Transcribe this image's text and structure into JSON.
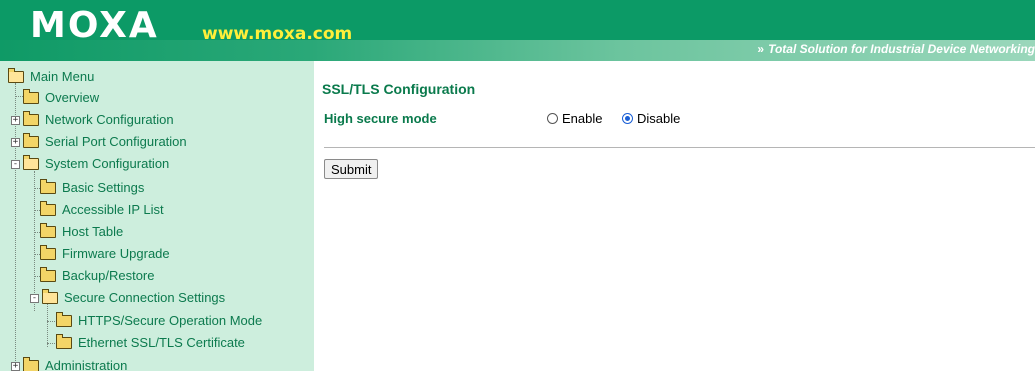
{
  "header": {
    "logo_text": "MOXA",
    "url_text": "www.moxa.com",
    "tagline_icon": "double-chevron-right-icon",
    "tagline": "Total Solution for Industrial Device Networking",
    "colors": {
      "bar": "#0c9a66",
      "url": "#ffef3a"
    }
  },
  "sidebar": {
    "root_label": "Main Menu",
    "items": [
      {
        "label": "Overview",
        "icon": "folder-icon"
      },
      {
        "label": "Network Configuration",
        "icon": "folder-icon",
        "expander": "+"
      },
      {
        "label": "Serial Port Configuration",
        "icon": "folder-icon",
        "expander": "+"
      },
      {
        "label": "System Configuration",
        "icon": "folder-open-icon",
        "expander": "-"
      },
      {
        "label": "Basic Settings",
        "icon": "folder-icon"
      },
      {
        "label": "Accessible IP List",
        "icon": "folder-icon"
      },
      {
        "label": "Host Table",
        "icon": "folder-icon"
      },
      {
        "label": "Firmware Upgrade",
        "icon": "folder-icon"
      },
      {
        "label": "Backup/Restore",
        "icon": "folder-icon"
      },
      {
        "label": "Secure Connection Settings",
        "icon": "folder-open-icon",
        "expander": "-"
      },
      {
        "label": "HTTPS/Secure Operation Mode",
        "icon": "folder-icon"
      },
      {
        "label": "Ethernet SSL/TLS Certificate",
        "icon": "folder-icon"
      },
      {
        "label": "Administration",
        "icon": "folder-icon",
        "expander": "+"
      }
    ],
    "colors": {
      "background": "#cdeedd",
      "text": "#0c7a4e"
    }
  },
  "main": {
    "title": "SSL/TLS Configuration",
    "high_secure_mode": {
      "label": "High secure mode",
      "options": [
        "Enable",
        "Disable"
      ],
      "selected": "Disable"
    },
    "submit_label": "Submit"
  }
}
